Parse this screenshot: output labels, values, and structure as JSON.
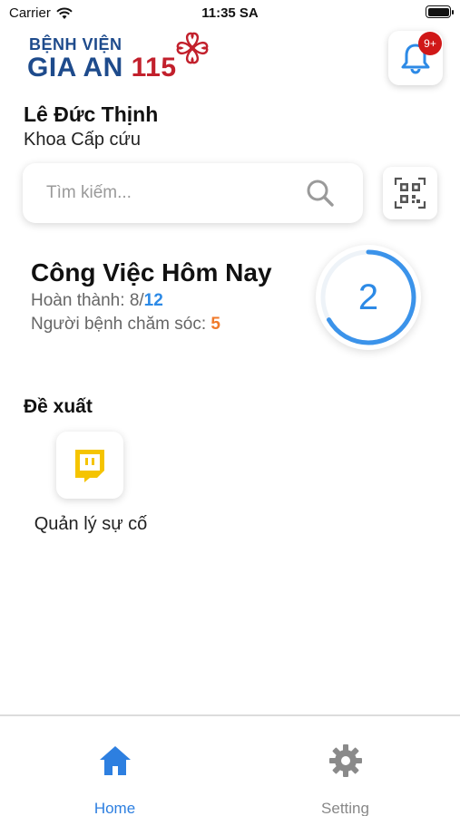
{
  "status_bar": {
    "carrier": "Carrier",
    "time": "11:35 SA"
  },
  "header": {
    "logo_line1": "BỆNH VIỆN",
    "logo_line2_text": "GIA AN",
    "logo_line2_number": "115",
    "notification_badge": "9+"
  },
  "user": {
    "name": "Lê Đức Thịnh",
    "department": "Khoa Cấp cứu"
  },
  "search": {
    "placeholder": "Tìm kiếm..."
  },
  "today_tasks": {
    "title": "Công Việc Hôm Nay",
    "completed_label": "Hoàn thành: ",
    "completed_value": "8",
    "total_value": "12",
    "patients_label": "Người bệnh chăm sóc: ",
    "patients_value": "5",
    "ring_value": "2",
    "ring_progress": 0.6667
  },
  "suggestions": {
    "title": "Đề xuất",
    "items": [
      {
        "label": "Quản lý sự cố",
        "icon": "chat-alert-icon"
      }
    ]
  },
  "tabbar": {
    "items": [
      {
        "label": "Home",
        "icon": "home-icon",
        "active": true
      },
      {
        "label": "Setting",
        "icon": "gear-icon",
        "active": false
      }
    ]
  },
  "colors": {
    "accent_blue": "#2d8ae6",
    "accent_orange": "#f07a2a",
    "brand_navy": "#1e4b8c",
    "brand_red": "#c2202c",
    "badge_red": "#d01818",
    "suggest_yellow": "#f5c400"
  }
}
